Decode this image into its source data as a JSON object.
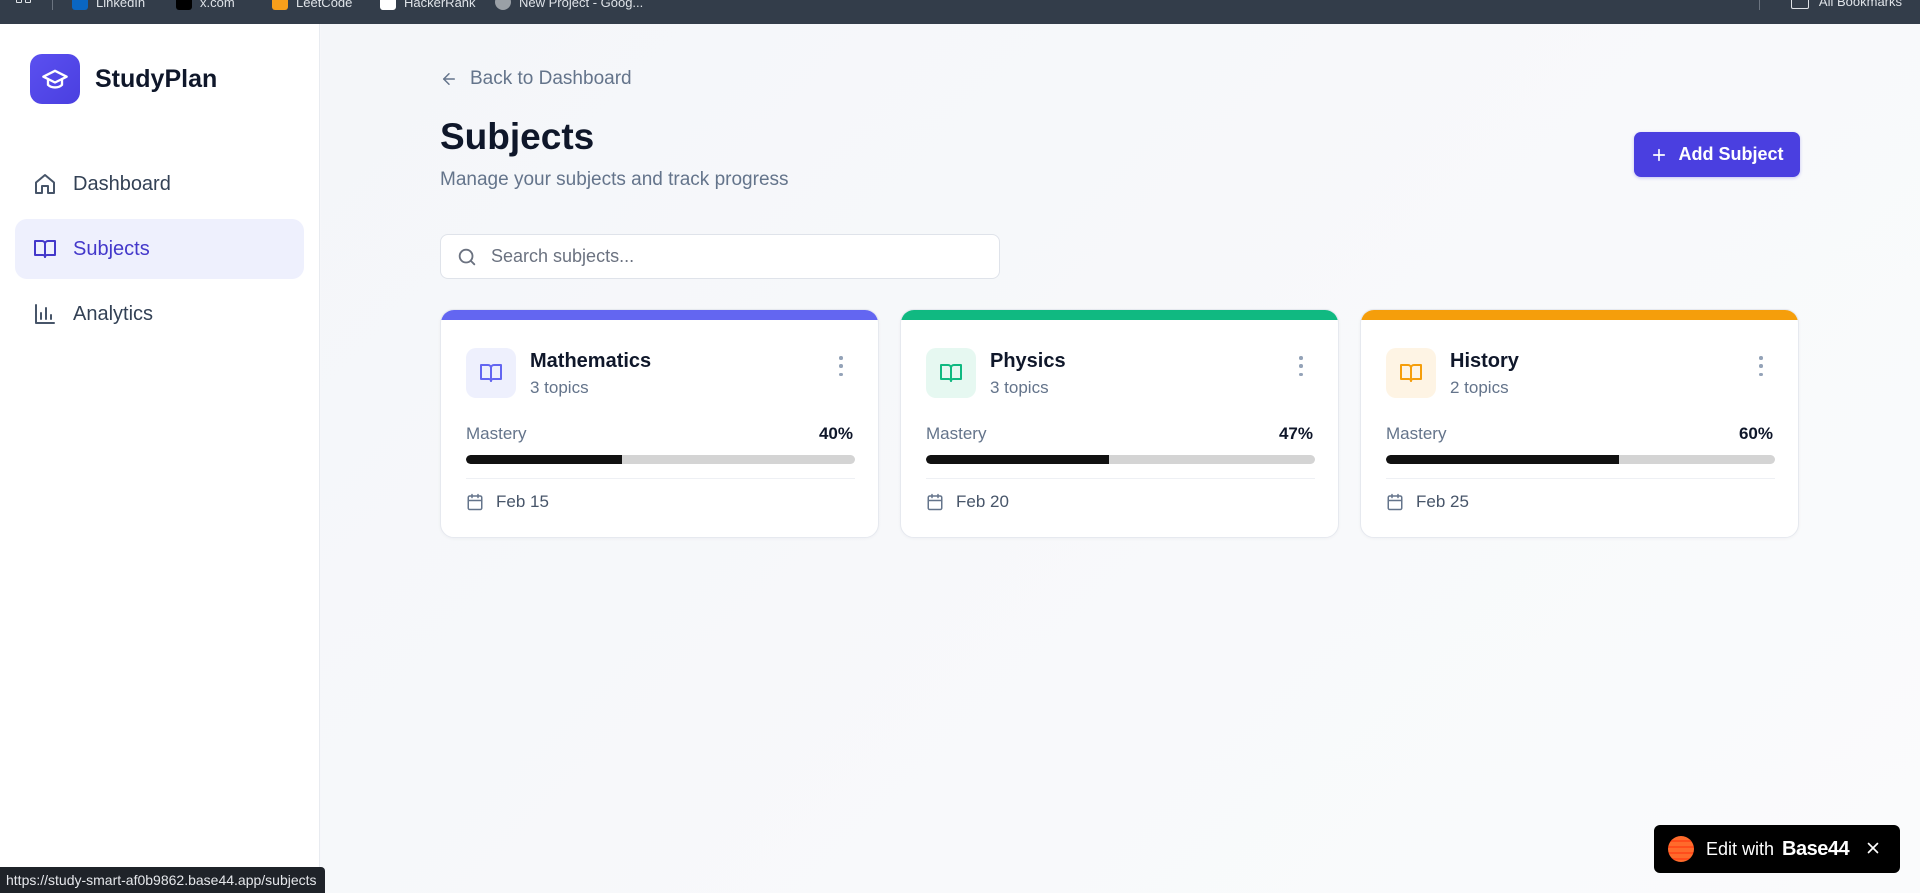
{
  "browser": {
    "bookmarks": [
      {
        "label": "LinkedIn",
        "icon": "linkedin-icon"
      },
      {
        "label": "x.com",
        "icon": "x-icon"
      },
      {
        "label": "LeetCode",
        "icon": "leetcode-icon"
      },
      {
        "label": "HackerRank",
        "icon": "hackerrank-icon"
      },
      {
        "label": "New Project - Goog...",
        "icon": "google-icon"
      }
    ],
    "all_bookmarks": "All Bookmarks"
  },
  "sidebar": {
    "brand": "StudyPlan",
    "items": [
      {
        "label": "Dashboard",
        "icon": "home-icon",
        "active": false
      },
      {
        "label": "Subjects",
        "icon": "book-open-icon",
        "active": true
      },
      {
        "label": "Analytics",
        "icon": "bar-chart-icon",
        "active": false
      }
    ]
  },
  "header": {
    "back_label": "Back to Dashboard",
    "title": "Subjects",
    "subtitle": "Manage your subjects and track progress",
    "add_button": "Add Subject"
  },
  "search": {
    "placeholder": "Search subjects..."
  },
  "subjects": [
    {
      "name": "Mathematics",
      "topics": "3 topics",
      "mastery_label": "Mastery",
      "mastery": "40%",
      "progress": 0.4,
      "date": "Feb 15",
      "color": "#6366f1",
      "icon_bg": "#eef0fd"
    },
    {
      "name": "Physics",
      "topics": "3 topics",
      "mastery_label": "Mastery",
      "mastery": "47%",
      "progress": 0.47,
      "date": "Feb 20",
      "color": "#10b981",
      "icon_bg": "#e6f8f1"
    },
    {
      "name": "History",
      "topics": "2 topics",
      "mastery_label": "Mastery",
      "mastery": "60%",
      "progress": 0.6,
      "date": "Feb 25",
      "color": "#f59e0b",
      "icon_bg": "#fef4e4"
    }
  ],
  "status_url": "https://study-smart-af0b9862.base44.app/subjects",
  "badge": {
    "edit_text": "Edit with",
    "brand": "Base44"
  }
}
